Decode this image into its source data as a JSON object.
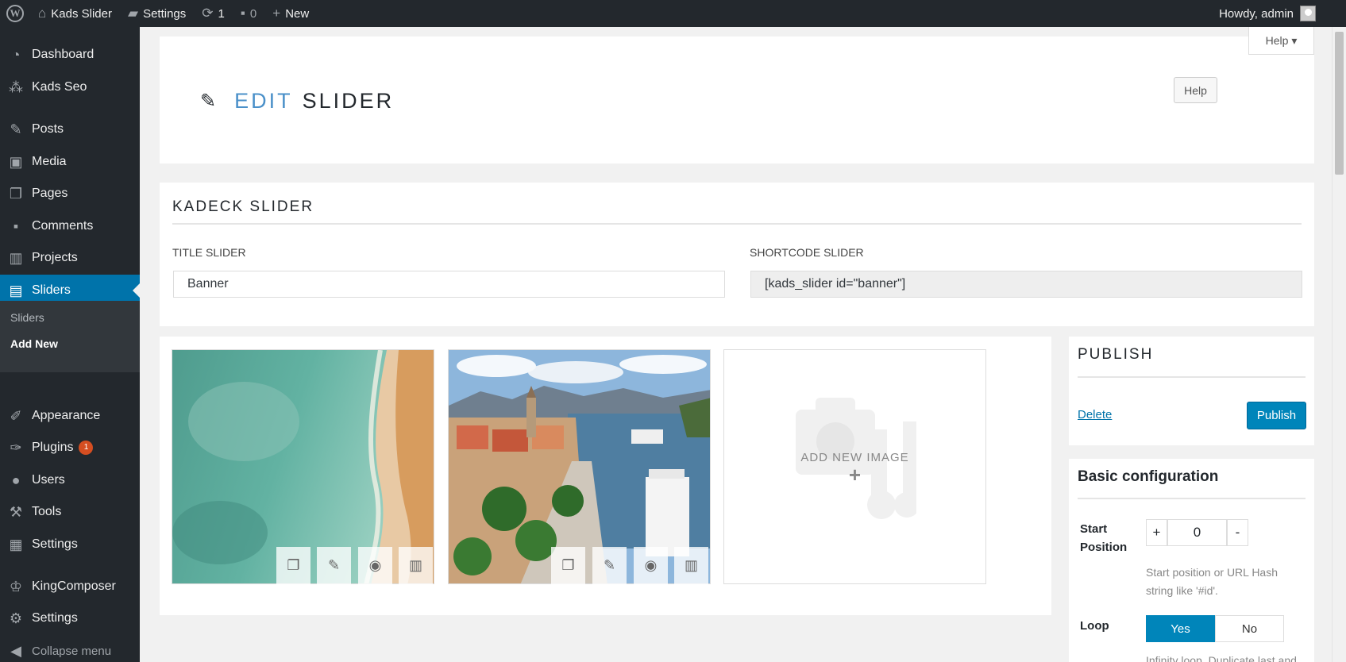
{
  "adminbar": {
    "site_name": "Kads Slider",
    "settings": "Settings",
    "updates_count": "1",
    "comments_count": "0",
    "new_label": "New",
    "howdy": "Howdy, admin"
  },
  "sidebar": {
    "items": [
      {
        "label": "Dashboard",
        "icon": "dashboard-icon"
      },
      {
        "label": "Kads Seo",
        "icon": "kads-seo-icon"
      },
      {
        "label": "Posts",
        "icon": "pin-icon"
      },
      {
        "label": "Media",
        "icon": "media-icon"
      },
      {
        "label": "Pages",
        "icon": "pages-icon"
      },
      {
        "label": "Comments",
        "icon": "comment-icon"
      },
      {
        "label": "Projects",
        "icon": "projects-icon"
      },
      {
        "label": "Sliders",
        "icon": "sliders-icon"
      },
      {
        "label": "Appearance",
        "icon": "brush-icon"
      },
      {
        "label": "Plugins",
        "icon": "plug-icon"
      },
      {
        "label": "Users",
        "icon": "user-icon"
      },
      {
        "label": "Tools",
        "icon": "wrench-icon"
      },
      {
        "label": "Settings",
        "icon": "settings-icon"
      },
      {
        "label": "KingComposer",
        "icon": "crown-icon"
      },
      {
        "label": "Settings",
        "icon": "gear-icon"
      }
    ],
    "submenu": [
      "Sliders",
      "Add New"
    ],
    "plugins_badge": "1",
    "collapse": "Collapse menu"
  },
  "header": {
    "help_tab": "Help",
    "title_prefix": "EDIT",
    "title_main": "SLIDER",
    "help_button": "Help"
  },
  "slider_card": {
    "section_title": "KADECK SLIDER",
    "title_label": "TITLE SLIDER",
    "title_value": "Banner",
    "shortcode_label": "SHORTCODE SLIDER",
    "shortcode_value": "[kads_slider id=\"banner\"]"
  },
  "images": {
    "add_new": "ADD NEW IMAGE",
    "plus": "+"
  },
  "publish": {
    "title": "PUBLISH",
    "delete": "Delete",
    "publish": "Publish"
  },
  "config": {
    "title": "Basic configuration",
    "start_label_1": "Start",
    "start_label_2": "Position",
    "stepper_plus": "+",
    "stepper_value": "0",
    "stepper_minus": "-",
    "start_help": "Start position or URL Hash string like '#id'.",
    "loop_label": "Loop",
    "yes": "Yes",
    "no": "No",
    "loop_help": "Infinity loop. Duplicate last and"
  },
  "colors": {
    "accent": "#0085ba",
    "sidebar_bg": "#23282d",
    "active": "#0073aa"
  }
}
